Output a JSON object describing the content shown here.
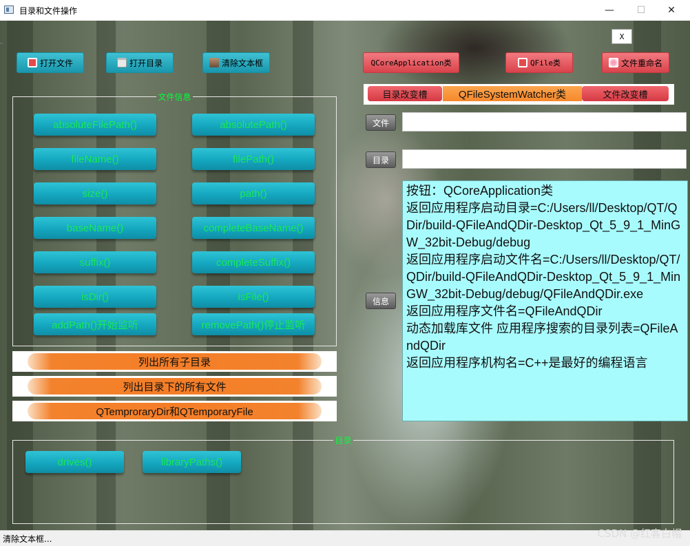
{
  "window": {
    "title": "目录和文件操作",
    "minimize": "—",
    "maximize": "☐",
    "close": "✕"
  },
  "toolbar": {
    "open_file": "打开文件",
    "open_dir": "打开目录",
    "clear_text": "清除文本框",
    "qcoreapp": "QCoreApplication类",
    "qfile": "QFile类",
    "rename": "文件重命名",
    "x_button": "X"
  },
  "file_info": {
    "legend": "文件信息",
    "buttons": [
      "absoluteFilePath()",
      "absolutePath()",
      "fileName()",
      "filePath()",
      "size()",
      "path()",
      "baseName()",
      "completeBaseName()",
      "suffix()",
      "completeSuffix()",
      "isDir()",
      "isFile()",
      "addPath()开始监听",
      "removePath()停止监听"
    ]
  },
  "list_buttons": [
    "列出所有子目录",
    "列出目录下的所有文件",
    "QTemproraryDir和QTemporaryFile"
  ],
  "dir_group": {
    "legend": "目录",
    "buttons": [
      "drives()",
      "libraryPaths()"
    ]
  },
  "watcher": {
    "dir_changed": "目录改变槽",
    "title": "QFileSystemWatcher类",
    "file_changed": "文件改变槽"
  },
  "labels": {
    "file": "文件",
    "dir": "目录",
    "info": "信息"
  },
  "file_input": {
    "value": ""
  },
  "dir_input": {
    "value": ""
  },
  "info_text": [
    "按钮：QCoreApplication类",
    "返回应用程序启动目录=C:/Users/ll/Desktop/QT/QDir/build-QFileAndQDir-Desktop_Qt_5_9_1_MinGW_32bit-Debug/debug",
    "返回应用程序启动文件名=C:/Users/ll/Desktop/QT/QDir/build-QFileAndQDir-Desktop_Qt_5_9_1_MinGW_32bit-Debug/debug/QFileAndQDir.exe",
    "返回应用程序文件名=QFileAndQDir",
    "动态加载库文件 应用程序搜索的目录列表=QFileAndQDir",
    "返回应用程序机构名=C++是最好的编程语言"
  ],
  "status": {
    "text": "清除文本框..."
  },
  "watermark": "CSDN @红客白帽",
  "colors": {
    "teal": "#14a7bf",
    "green_text": "#19e856",
    "orange": "#f47e27",
    "info_bg": "#a8fbfd",
    "red_button": "#d9434b"
  }
}
